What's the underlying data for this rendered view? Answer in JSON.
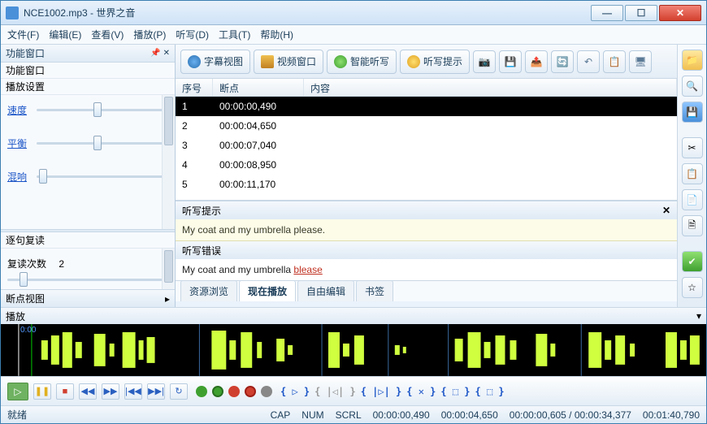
{
  "title": "NCE1002.mp3 - 世界之音",
  "menu": [
    "文件(F)",
    "编辑(E)",
    "查看(V)",
    "播放(P)",
    "听写(D)",
    "工具(T)",
    "帮助(H)"
  ],
  "left": {
    "funcwin": "功能窗口",
    "funcwin2": "功能窗口",
    "playset": "播放设置",
    "sliders": {
      "speed": "速度",
      "balance": "平衡",
      "reverb": "混响"
    },
    "sentence": "逐句复读",
    "repeatLabel": "复读次数",
    "repeatCount": "2",
    "bpview": "断点视图"
  },
  "toolbar": {
    "sub": "字幕视图",
    "vid": "视频窗口",
    "smart": "智能听写",
    "hint": "听写提示"
  },
  "table": {
    "headers": {
      "seq": "序号",
      "bp": "断点",
      "content": "内容"
    },
    "rows": [
      {
        "seq": "1",
        "bp": "00:00:00,490"
      },
      {
        "seq": "2",
        "bp": "00:00:04,650"
      },
      {
        "seq": "3",
        "bp": "00:00:07,040"
      },
      {
        "seq": "4",
        "bp": "00:00:08,950"
      },
      {
        "seq": "5",
        "bp": "00:00:11,170"
      }
    ]
  },
  "hint": {
    "title": "听写提示",
    "text": "My coat and my umbrella please."
  },
  "err": {
    "title": "听写错误",
    "ok": "My coat and my umbrella ",
    "wrong": "blease"
  },
  "tabs": [
    "资源浏览",
    "现在播放",
    "自由编辑",
    "书签"
  ],
  "playLabel": "播放",
  "waveTs": "0:00",
  "bracket": {
    "a": "{ ▷ }",
    "b": "{ |◁| }",
    "c": "{ |▷| }",
    "d": "{ ✕ }",
    "e": "{ ⬚ }",
    "f": "{ ⬚ }"
  },
  "status": {
    "ready": "就绪",
    "cap": "CAP",
    "num": "NUM",
    "scrl": "SCRL",
    "t1": "00:00:00,490",
    "t2": "00:00:04,650",
    "t3": "00:00:00,605 / 00:00:34,377",
    "t4": "00:01:40,790"
  }
}
